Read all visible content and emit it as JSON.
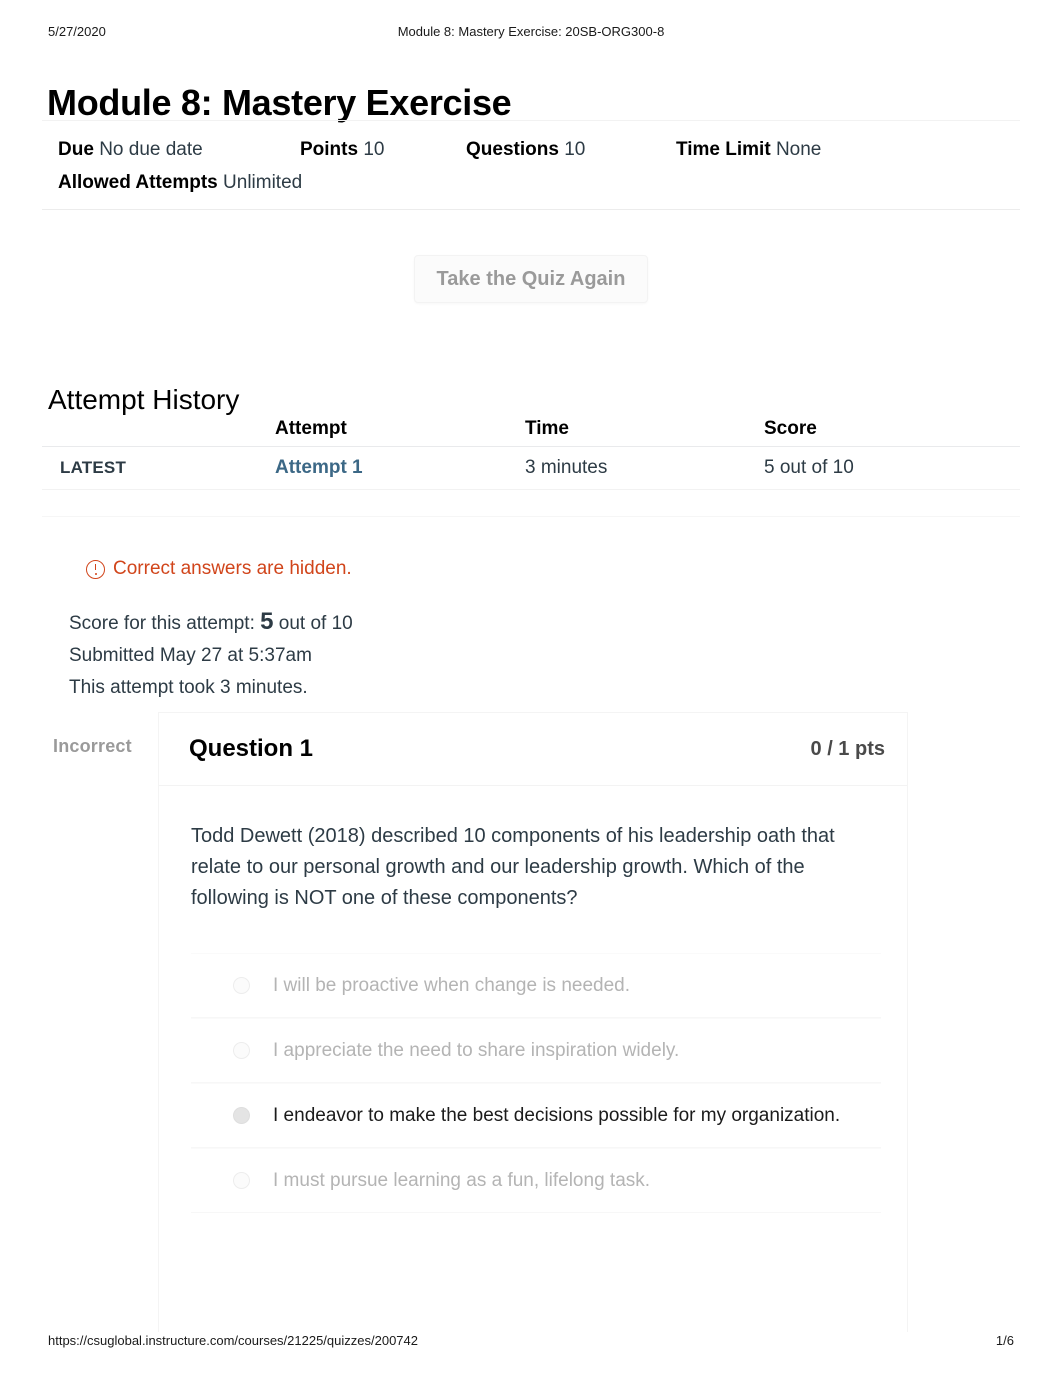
{
  "print_header": {
    "date": "5/27/2020",
    "title": "Module 8: Mastery Exercise: 20SB-ORG300-8"
  },
  "quiz": {
    "title": "Module 8: Mastery Exercise",
    "details": [
      {
        "key": "Due",
        "value": "No due date"
      },
      {
        "key": "Points",
        "value": "10"
      },
      {
        "key": "Questions",
        "value": "10"
      },
      {
        "key": "Time Limit",
        "value": "None"
      },
      {
        "key": "Allowed Attempts",
        "value": "Unlimited"
      }
    ],
    "retake_label": "Take the Quiz Again"
  },
  "attempt_history": {
    "heading": "Attempt History",
    "columns": [
      "",
      "Attempt",
      "Time",
      "Score"
    ],
    "rows": [
      {
        "kind": "LATEST",
        "attempt": "Attempt 1",
        "time": "3 minutes",
        "score": "5 out of 10"
      }
    ]
  },
  "notice": {
    "text": "Correct answers are hidden.",
    "color": "#d1451b",
    "icon": "alert-circle-icon"
  },
  "attempt_summary": {
    "score_prefix": "Score for this attempt:",
    "score_value": "5",
    "score_suffix": "out of 10",
    "submitted": "Submitted May 27 at 5:37am",
    "duration": "This attempt took 3 minutes."
  },
  "question": {
    "status": "Incorrect",
    "name": "Question 1",
    "points": "0 / 1 pts",
    "text": "Todd Dewett (2018) described 10 components of his leadership oath that relate to our personal growth and our leadership growth. Which of the following is NOT one of these components?",
    "answers": [
      {
        "text": "I will be proactive when change is needed.",
        "selected": false
      },
      {
        "text": "I appreciate the need to share inspiration widely.",
        "selected": false
      },
      {
        "text": "I endeavor to make the best decisions possible for my organization.",
        "selected": true
      },
      {
        "text": "I must pursue learning as a fun, lifelong task.",
        "selected": false
      }
    ]
  },
  "print_footer": {
    "url": "https://csuglobal.instructure.com/courses/21225/quizzes/200742",
    "page": "1/6"
  }
}
